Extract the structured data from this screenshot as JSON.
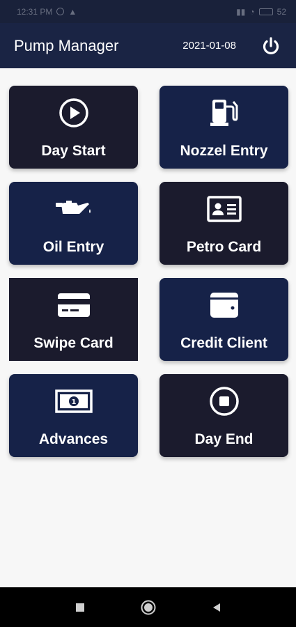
{
  "status_bar": {
    "time": "12:31 PM",
    "battery": "52"
  },
  "app_bar": {
    "title": "Pump Manager",
    "date": "2021-01-08",
    "power_icon": "power-icon"
  },
  "tiles": [
    {
      "label": "Day Start",
      "icon": "play-circle-icon"
    },
    {
      "label": "Nozzel Entry",
      "icon": "fuel-pump-icon"
    },
    {
      "label": "Oil Entry",
      "icon": "oil-can-icon"
    },
    {
      "label": "Petro Card",
      "icon": "id-card-icon"
    },
    {
      "label": "Swipe Card",
      "icon": "credit-card-icon"
    },
    {
      "label": "Credit Client",
      "icon": "wallet-icon"
    },
    {
      "label": "Advances",
      "icon": "money-bill-icon"
    },
    {
      "label": "Day End",
      "icon": "stop-circle-icon"
    }
  ],
  "colors": {
    "app_bar": "#1a2444",
    "tile_dark": "#1b1b2d",
    "tile_navy": "#162248",
    "background": "#f7f7f7"
  },
  "nav_bar": {
    "icons": [
      "recent-apps-icon",
      "home-icon",
      "back-icon"
    ]
  }
}
